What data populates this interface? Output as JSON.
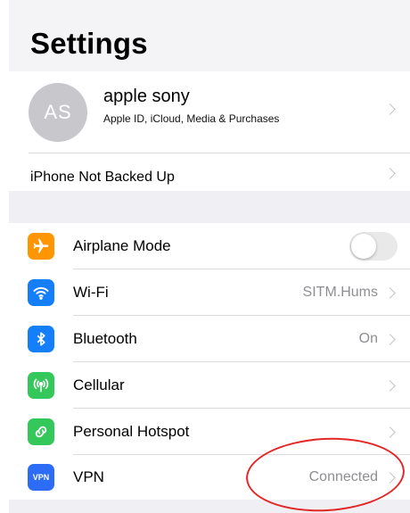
{
  "header": {
    "title": "Settings"
  },
  "profile": {
    "initials": "AS",
    "name": "apple sony",
    "subtitle": "Apple ID, iCloud, Media & Purchases"
  },
  "backup": {
    "label": "iPhone Not Backed Up"
  },
  "network": {
    "airplane": {
      "label": "Airplane Mode",
      "icon": "airplane-icon",
      "color": "#ff9500",
      "toggle_on": false
    },
    "wifi": {
      "label": "Wi-Fi",
      "value": "SITM.Hums",
      "icon": "wifi-icon",
      "color": "#147efb"
    },
    "bluetooth": {
      "label": "Bluetooth",
      "value": "On",
      "icon": "bluetooth-icon",
      "color": "#147efb"
    },
    "cellular": {
      "label": "Cellular",
      "icon": "cellular-antenna-icon",
      "color": "#34c759"
    },
    "hotspot": {
      "label": "Personal Hotspot",
      "icon": "hotspot-link-icon",
      "color": "#34c759"
    },
    "vpn": {
      "label": "VPN",
      "value": "Connected",
      "icon": "vpn-icon",
      "icon_text": "VPN",
      "color": "#2c6cf6"
    }
  },
  "annotation": {
    "color": "#e32626",
    "target": "vpn.value"
  }
}
